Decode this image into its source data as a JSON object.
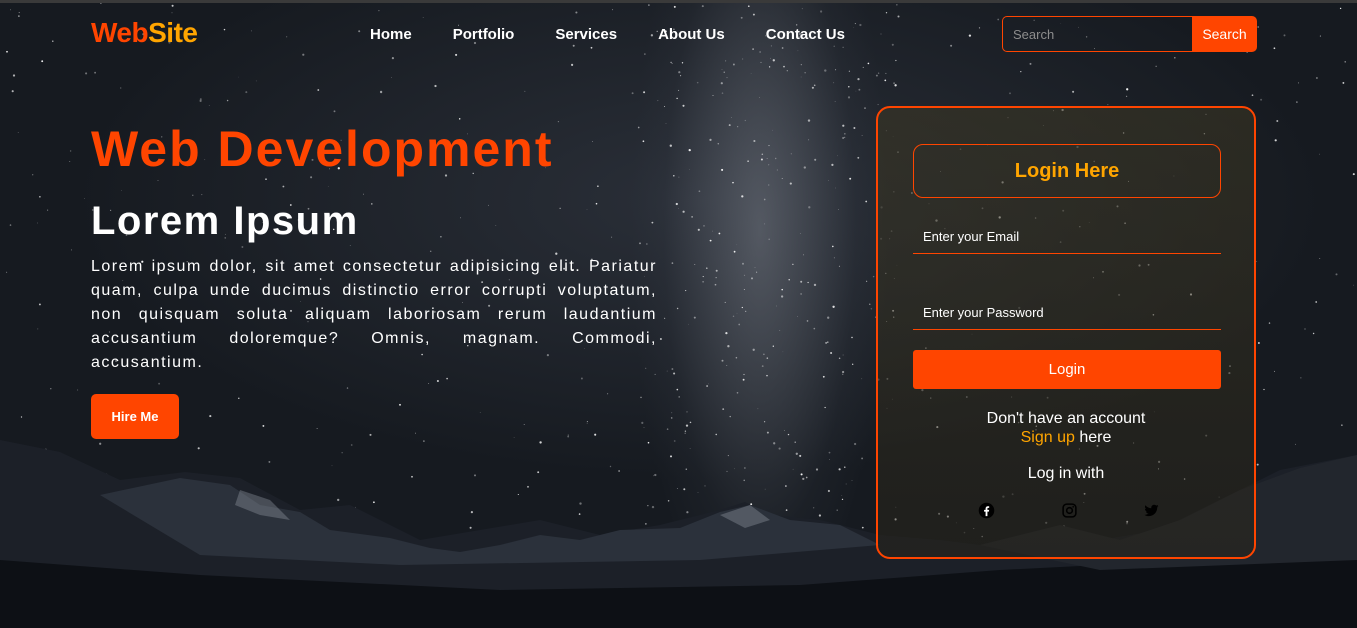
{
  "header": {
    "logo_part1": "Web",
    "logo_part2": "Site",
    "nav": [
      "Home",
      "Portfolio",
      "Services",
      "About Us",
      "Contact Us"
    ],
    "search_placeholder": "Search",
    "search_button": "Search"
  },
  "hero": {
    "title": "Web Development",
    "subtitle": "Lorem Ipsum",
    "text": "Lorem ipsum dolor, sit amet consectetur adipisicing elit. Pariatur quam, culpa unde ducimus distinctio error corrupti voluptatum, non quisquam soluta aliquam laboriosam rerum laudantium accusantium doloremque? Omnis, magnam. Commodi, accusantium.",
    "hire_button": "Hire Me"
  },
  "login": {
    "title": "Login Here",
    "email_placeholder": "Enter your Email",
    "password_placeholder": "Enter your Password",
    "login_button": "Login",
    "no_account": "Don't have an account",
    "signup_link": "Sign up",
    "signup_suffix": " here",
    "login_with": "Log in with",
    "socials": [
      "facebook-icon",
      "instagram-icon",
      "twitter-icon"
    ]
  },
  "colors": {
    "primary": "#ff4500",
    "accent": "#ffa500"
  }
}
